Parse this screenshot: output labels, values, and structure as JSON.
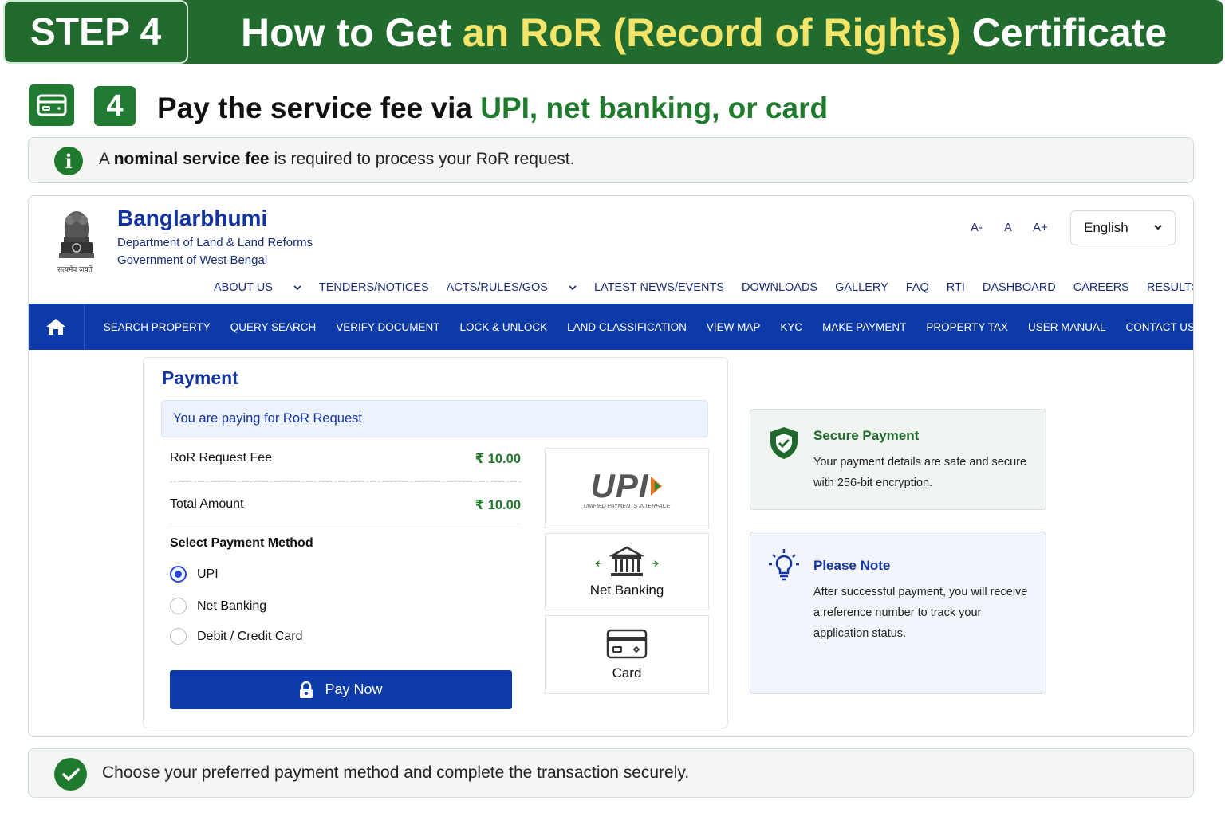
{
  "banner": {
    "step": "STEP 4",
    "title_pre": "How to Get ",
    "title_highlight": "an RoR (Record of Rights)",
    "title_post": " Certificate"
  },
  "substep": {
    "number": "4",
    "text": "Pay the service fee via ",
    "highlight": "UPI, net banking, or card"
  },
  "info": {
    "pre": "A ",
    "bold": "nominal service fee",
    "post": " is required to process your RoR request."
  },
  "site": {
    "name": "Banglarbhumi",
    "department": "Department of Land & Land Reforms",
    "government": "Government of West Bengal",
    "emblem_motto": "सत्यमेव जयते",
    "font_controls": [
      "A-",
      "A",
      "A+"
    ],
    "language": "English",
    "top_nav": [
      "ABOUT US",
      "TENDERS/NOTICES",
      "ACTS/RULES/GOS",
      "LATEST NEWS/EVENTS",
      "DOWNLOADS",
      "GALLERY",
      "FAQ",
      "RTI",
      "DASHBOARD",
      "CAREERS",
      "RESULTS"
    ],
    "main_nav": [
      "SEARCH PROPERTY",
      "QUERY SEARCH",
      "VERIFY DOCUMENT",
      "LOCK & UNLOCK",
      "LAND CLASSIFICATION",
      "VIEW MAP",
      "KYC",
      "MAKE PAYMENT",
      "PROPERTY TAX",
      "USER MANUAL",
      "CONTACT US"
    ]
  },
  "payment": {
    "title": "Payment",
    "paying_for": "You are paying for RoR Request",
    "fee_label": "RoR Request Fee",
    "fee_value": "₹ 10.00",
    "total_label": "Total Amount",
    "total_value": "₹ 10.00",
    "method_heading": "Select Payment Method",
    "methods": [
      "UPI",
      "Net Banking",
      "Debit / Credit Card"
    ],
    "selected_method": "UPI",
    "pay_button": "Pay Now",
    "options": {
      "upi_logo": "UPI",
      "upi_tagline": "UNIFIED PAYMENTS INTERFACE",
      "netbanking": "Net Banking",
      "card": "Card"
    }
  },
  "secure": {
    "title": "Secure Payment",
    "body": "Your payment details are safe and secure with 256-bit encryption."
  },
  "note": {
    "title": "Please Note",
    "body": "After successful payment, you will receive a reference number to track your application status."
  },
  "footer": {
    "text": "Choose your preferred payment method and complete the transaction securely."
  },
  "colors": {
    "brand_green": "#216b2e",
    "highlight_yellow": "#f5e46a",
    "nav_blue": "#0c3aa8",
    "title_blue": "#1333a0"
  }
}
